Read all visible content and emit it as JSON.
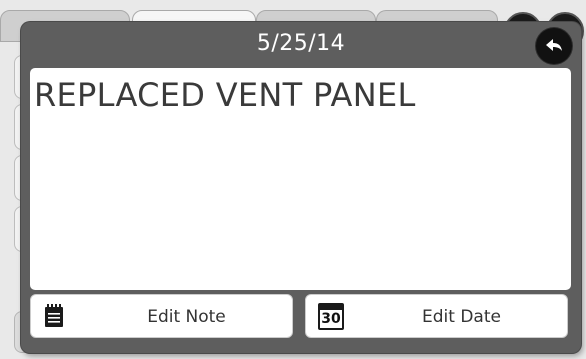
{
  "dialog": {
    "title": "5/25/14",
    "note_text": "REPLACED VENT PANEL",
    "back_icon": "back-arrow-icon"
  },
  "actions": {
    "edit_note_label": "Edit Note",
    "edit_note_icon": "notepad-icon",
    "edit_date_label": "Edit Date",
    "edit_date_icon": "calendar-icon",
    "calendar_day": "30"
  },
  "colors": {
    "dialog_background": "#5e5e5e",
    "panel_background": "#ffffff",
    "back_button": "#111111"
  }
}
